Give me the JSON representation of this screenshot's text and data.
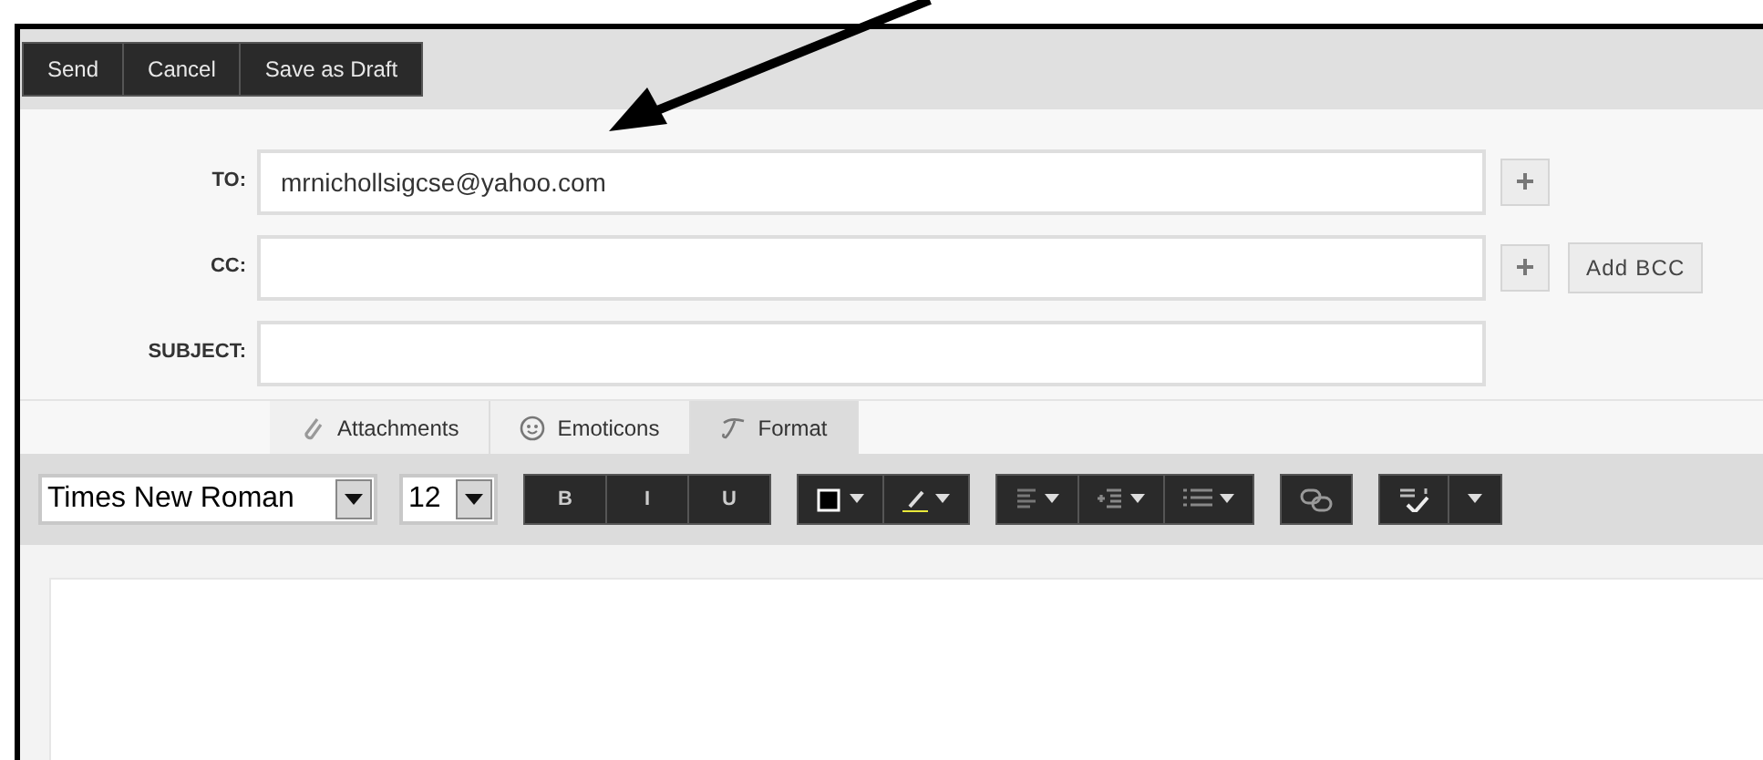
{
  "actions": [
    {
      "label": "Send"
    },
    {
      "label": "Cancel"
    },
    {
      "label": "Save as Draft"
    }
  ],
  "fields": [
    {
      "label": "TO:",
      "value": "mrnichollsigcse@yahoo.com",
      "add": true
    },
    {
      "label": "CC:",
      "add": true,
      "add_bcc": "Add BCC"
    },
    {
      "label": "SUBJECT:",
      "add": false
    }
  ],
  "tabs": [
    {
      "label": "Attachments",
      "kind": "paperclip",
      "selected": false
    },
    {
      "label": "Emoticons",
      "kind": "smiley",
      "selected": false
    },
    {
      "label": "Format",
      "kind": "script",
      "selected": true
    }
  ],
  "font": {
    "family": "Times New Roman",
    "size": "12"
  },
  "format_groups": [
    [
      {
        "kind": "text",
        "label": "B"
      },
      {
        "kind": "text",
        "label": "I"
      },
      {
        "kind": "text",
        "label": "U"
      }
    ],
    [
      {
        "kind": "textcolor"
      },
      {
        "kind": "highlight"
      }
    ],
    [
      {
        "kind": "align"
      },
      {
        "kind": "indent"
      },
      {
        "kind": "list"
      }
    ],
    [
      {
        "kind": "link"
      }
    ],
    [
      {
        "kind": "spellcheck"
      },
      {
        "kind": "menu"
      }
    ]
  ]
}
